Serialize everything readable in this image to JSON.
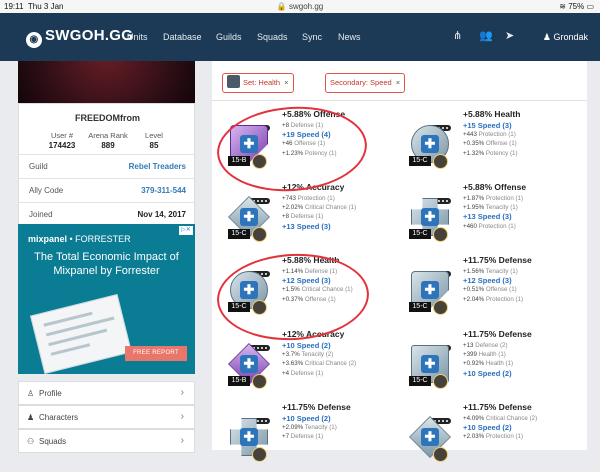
{
  "status": {
    "time": "19:11",
    "date": "Thu 3 Jan",
    "url": "swgoh.gg",
    "battery": "75%"
  },
  "nav": {
    "logo": "SWGOH.GG",
    "links": [
      "Units",
      "Database",
      "Guilds",
      "Squads",
      "Sync",
      "News"
    ],
    "username": "Grondak"
  },
  "profile": {
    "name": "FREEDOMfrom",
    "stats": [
      {
        "label": "User #",
        "value": "174423"
      },
      {
        "label": "Arena Rank",
        "value": "889"
      },
      {
        "label": "Level",
        "value": "85"
      }
    ],
    "rows": [
      {
        "label": "Guild",
        "value": "Rebel Treaders"
      },
      {
        "label": "Ally Code",
        "value": "379-311-544"
      },
      {
        "label": "Joined",
        "value": "Nov 14, 2017"
      }
    ]
  },
  "ad": {
    "brand": "mixpanel",
    "partner": "• FORRESTER",
    "headline": "The Total Economic Impact of Mixpanel by Forrester",
    "button": "FREE REPORT"
  },
  "side_nav": [
    {
      "label": "Profile",
      "icon": "user-icon"
    },
    {
      "label": "Characters",
      "icon": "characters-icon"
    },
    {
      "label": "Squads",
      "icon": "squads-icon"
    }
  ],
  "filters": [
    {
      "label": "Set: Health",
      "icon": "health-set-icon"
    },
    {
      "label": "Secondary: Speed"
    }
  ],
  "mods": [
    {
      "primary": "+5.88% Offense",
      "level": "15-B",
      "shape": "arrow",
      "color": "purple",
      "secondaries": [
        {
          "v": "+8",
          "n": "Defense (1)"
        },
        {
          "v": "+19 Speed (4)",
          "hl": true
        },
        {
          "v": "+46",
          "n": "Offense (1)"
        },
        {
          "v": "+1.23%",
          "n": "Potency (1)"
        }
      ]
    },
    {
      "primary": "+5.88% Health",
      "level": "15-C",
      "shape": "circle",
      "color": "grey",
      "secondaries": [
        {
          "v": "+15 Speed (3)",
          "hl": true
        },
        {
          "v": "+443",
          "n": "Protection (1)"
        },
        {
          "v": "+0.35%",
          "n": "Offense (1)"
        },
        {
          "v": "+1.32%",
          "n": "Potency (1)"
        }
      ]
    },
    {
      "primary": "+12% Accuracy",
      "level": "15-C",
      "shape": "diamond",
      "color": "grey",
      "secondaries": [
        {
          "v": "+743",
          "n": "Protection (1)"
        },
        {
          "v": "+2.02%",
          "n": "Critical Chance (1)"
        },
        {
          "v": "+8",
          "n": "Defense (1)"
        },
        {
          "v": "+13 Speed (3)",
          "hl": true
        }
      ]
    },
    {
      "primary": "+5.88% Offense",
      "level": "15-C",
      "shape": "cross",
      "color": "grey",
      "secondaries": [
        {
          "v": "+1.87%",
          "n": "Protection (1)"
        },
        {
          "v": "+1.95%",
          "n": "Tenacity (1)"
        },
        {
          "v": "+13 Speed (3)",
          "hl": true
        },
        {
          "v": "+460",
          "n": "Protection (1)"
        }
      ]
    },
    {
      "primary": "+5.88% Health",
      "level": "15-C",
      "shape": "circle",
      "color": "grey",
      "secondaries": [
        {
          "v": "+1.14%",
          "n": "Defense (1)"
        },
        {
          "v": "+12 Speed (3)",
          "hl": true
        },
        {
          "v": "+1.5%",
          "n": "Critical Chance (1)"
        },
        {
          "v": "+0.37%",
          "n": "Offense (1)"
        }
      ]
    },
    {
      "primary": "+11.75% Defense",
      "level": "15-C",
      "shape": "arrow",
      "color": "grey",
      "secondaries": [
        {
          "v": "+1.56%",
          "n": "Tenacity (1)"
        },
        {
          "v": "+12 Speed (3)",
          "hl": true
        },
        {
          "v": "+0.51%",
          "n": "Offense (1)"
        },
        {
          "v": "+2.04%",
          "n": "Protection (1)"
        }
      ]
    },
    {
      "primary": "+12% Accuracy",
      "level": "15-B",
      "shape": "diamond",
      "color": "purple",
      "secondaries": [
        {
          "v": "+10 Speed (2)",
          "hl": true
        },
        {
          "v": "+3.7%",
          "n": "Tenacity (2)"
        },
        {
          "v": "+3.63%",
          "n": "Critical Chance (2)"
        },
        {
          "v": "+4",
          "n": "Defense (1)"
        }
      ]
    },
    {
      "primary": "+11.75% Defense",
      "level": "15-C",
      "shape": "square",
      "color": "grey",
      "secondaries": [
        {
          "v": "+13",
          "n": "Defense (2)"
        },
        {
          "v": "+399",
          "n": "Health (1)"
        },
        {
          "v": "+0.92%",
          "n": "Health (1)"
        },
        {
          "v": "+10 Speed (2)",
          "hl": true
        }
      ]
    },
    {
      "primary": "+11.75% Defense",
      "level": "",
      "shape": "cross",
      "color": "grey",
      "secondaries": [
        {
          "v": "+10 Speed (2)",
          "hl": true
        },
        {
          "v": "+2.09%",
          "n": "Tenacity (1)"
        },
        {
          "v": "+7",
          "n": "Defense (1)"
        }
      ]
    },
    {
      "primary": "+11.75% Defense",
      "level": "",
      "shape": "diamond",
      "color": "grey",
      "secondaries": [
        {
          "v": "+4.09%",
          "n": "Critical Chance (2)"
        },
        {
          "v": "+10 Speed (2)",
          "hl": true
        },
        {
          "v": "+2.03%",
          "n": "Protection (1)"
        }
      ]
    }
  ]
}
